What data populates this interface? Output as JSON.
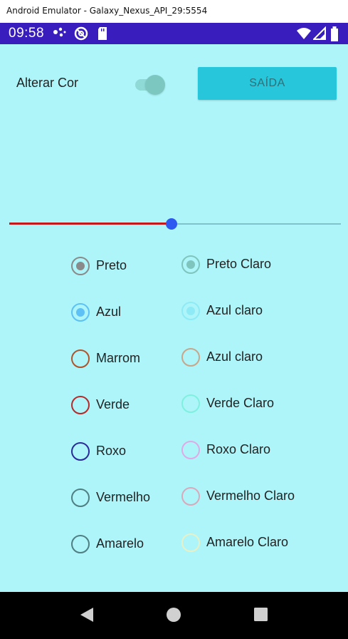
{
  "window": {
    "title": "Android Emulator - Galaxy_Nexus_API_29:5554"
  },
  "status_bar": {
    "time": "09:58"
  },
  "controls": {
    "switch_label": "Alterar Cor",
    "exit_label": "SAÍDA"
  },
  "slider": {
    "value_fraction": 0.49
  },
  "colors": {
    "app_background": "#aef5fa",
    "exit_button": "#28c6da",
    "slider_active": "#c4181b",
    "slider_thumb": "#2e58f0"
  },
  "radio_left": [
    {
      "label": "Preto",
      "color": "#8a8a8a",
      "checked": true
    },
    {
      "label": "Azul",
      "color": "#5ec1f5",
      "checked": true
    },
    {
      "label": "Marrom",
      "color": "#b0532a",
      "checked": false
    },
    {
      "label": "Verde",
      "color": "#b52a2a",
      "checked": false
    },
    {
      "label": "Roxo",
      "color": "#2a2a9a",
      "checked": false
    },
    {
      "label": "Vermelho",
      "color": "#4f7f82",
      "checked": false
    },
    {
      "label": "Amarelo",
      "color": "#4f7f82",
      "checked": false
    }
  ],
  "radio_right": [
    {
      "label": "Preto Claro",
      "color": "#7fc4bd",
      "checked": true
    },
    {
      "label": "Azul claro",
      "color": "#8eeaf5",
      "checked": true
    },
    {
      "label": "Azul claro",
      "color": "#c9a58a",
      "checked": false
    },
    {
      "label": "Verde Claro",
      "color": "#7ff0df",
      "checked": false
    },
    {
      "label": "Roxo Claro",
      "color": "#e0a9e6",
      "checked": false
    },
    {
      "label": "Vermelho Claro",
      "color": "#d9a9bb",
      "checked": false
    },
    {
      "label": "Amarelo Claro",
      "color": "#e8f0c6",
      "checked": false
    }
  ],
  "icons": {
    "status": [
      "dots-icon",
      "sync-icon",
      "sd-card-icon",
      "wifi-icon",
      "signal-icon",
      "battery-icon"
    ],
    "nav": [
      "back-icon",
      "home-icon",
      "recents-icon"
    ]
  }
}
